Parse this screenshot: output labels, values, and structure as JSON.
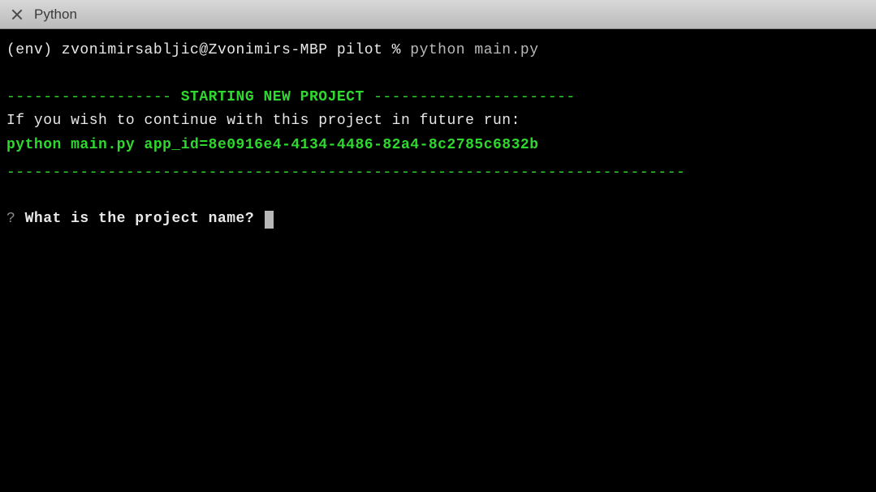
{
  "titlebar": {
    "title": "Python"
  },
  "terminal": {
    "prompt_prefix": "(env) zvonimirsabljic@Zvonimirs-MBP pilot % ",
    "command": "python main.py",
    "divider_left": "------------------ ",
    "heading": "STARTING NEW PROJECT",
    "divider_right": " ----------------------",
    "continue_msg": "If you wish to continue with this project in future run:",
    "continue_cmd": "python main.py app_id=8e0916e4-4134-4486-82a4-8c2785c6832b",
    "divider_bottom": "--------------------------------------------------------------------------",
    "prompt_q_mark": "?",
    "prompt_question": " What is the project name? "
  }
}
